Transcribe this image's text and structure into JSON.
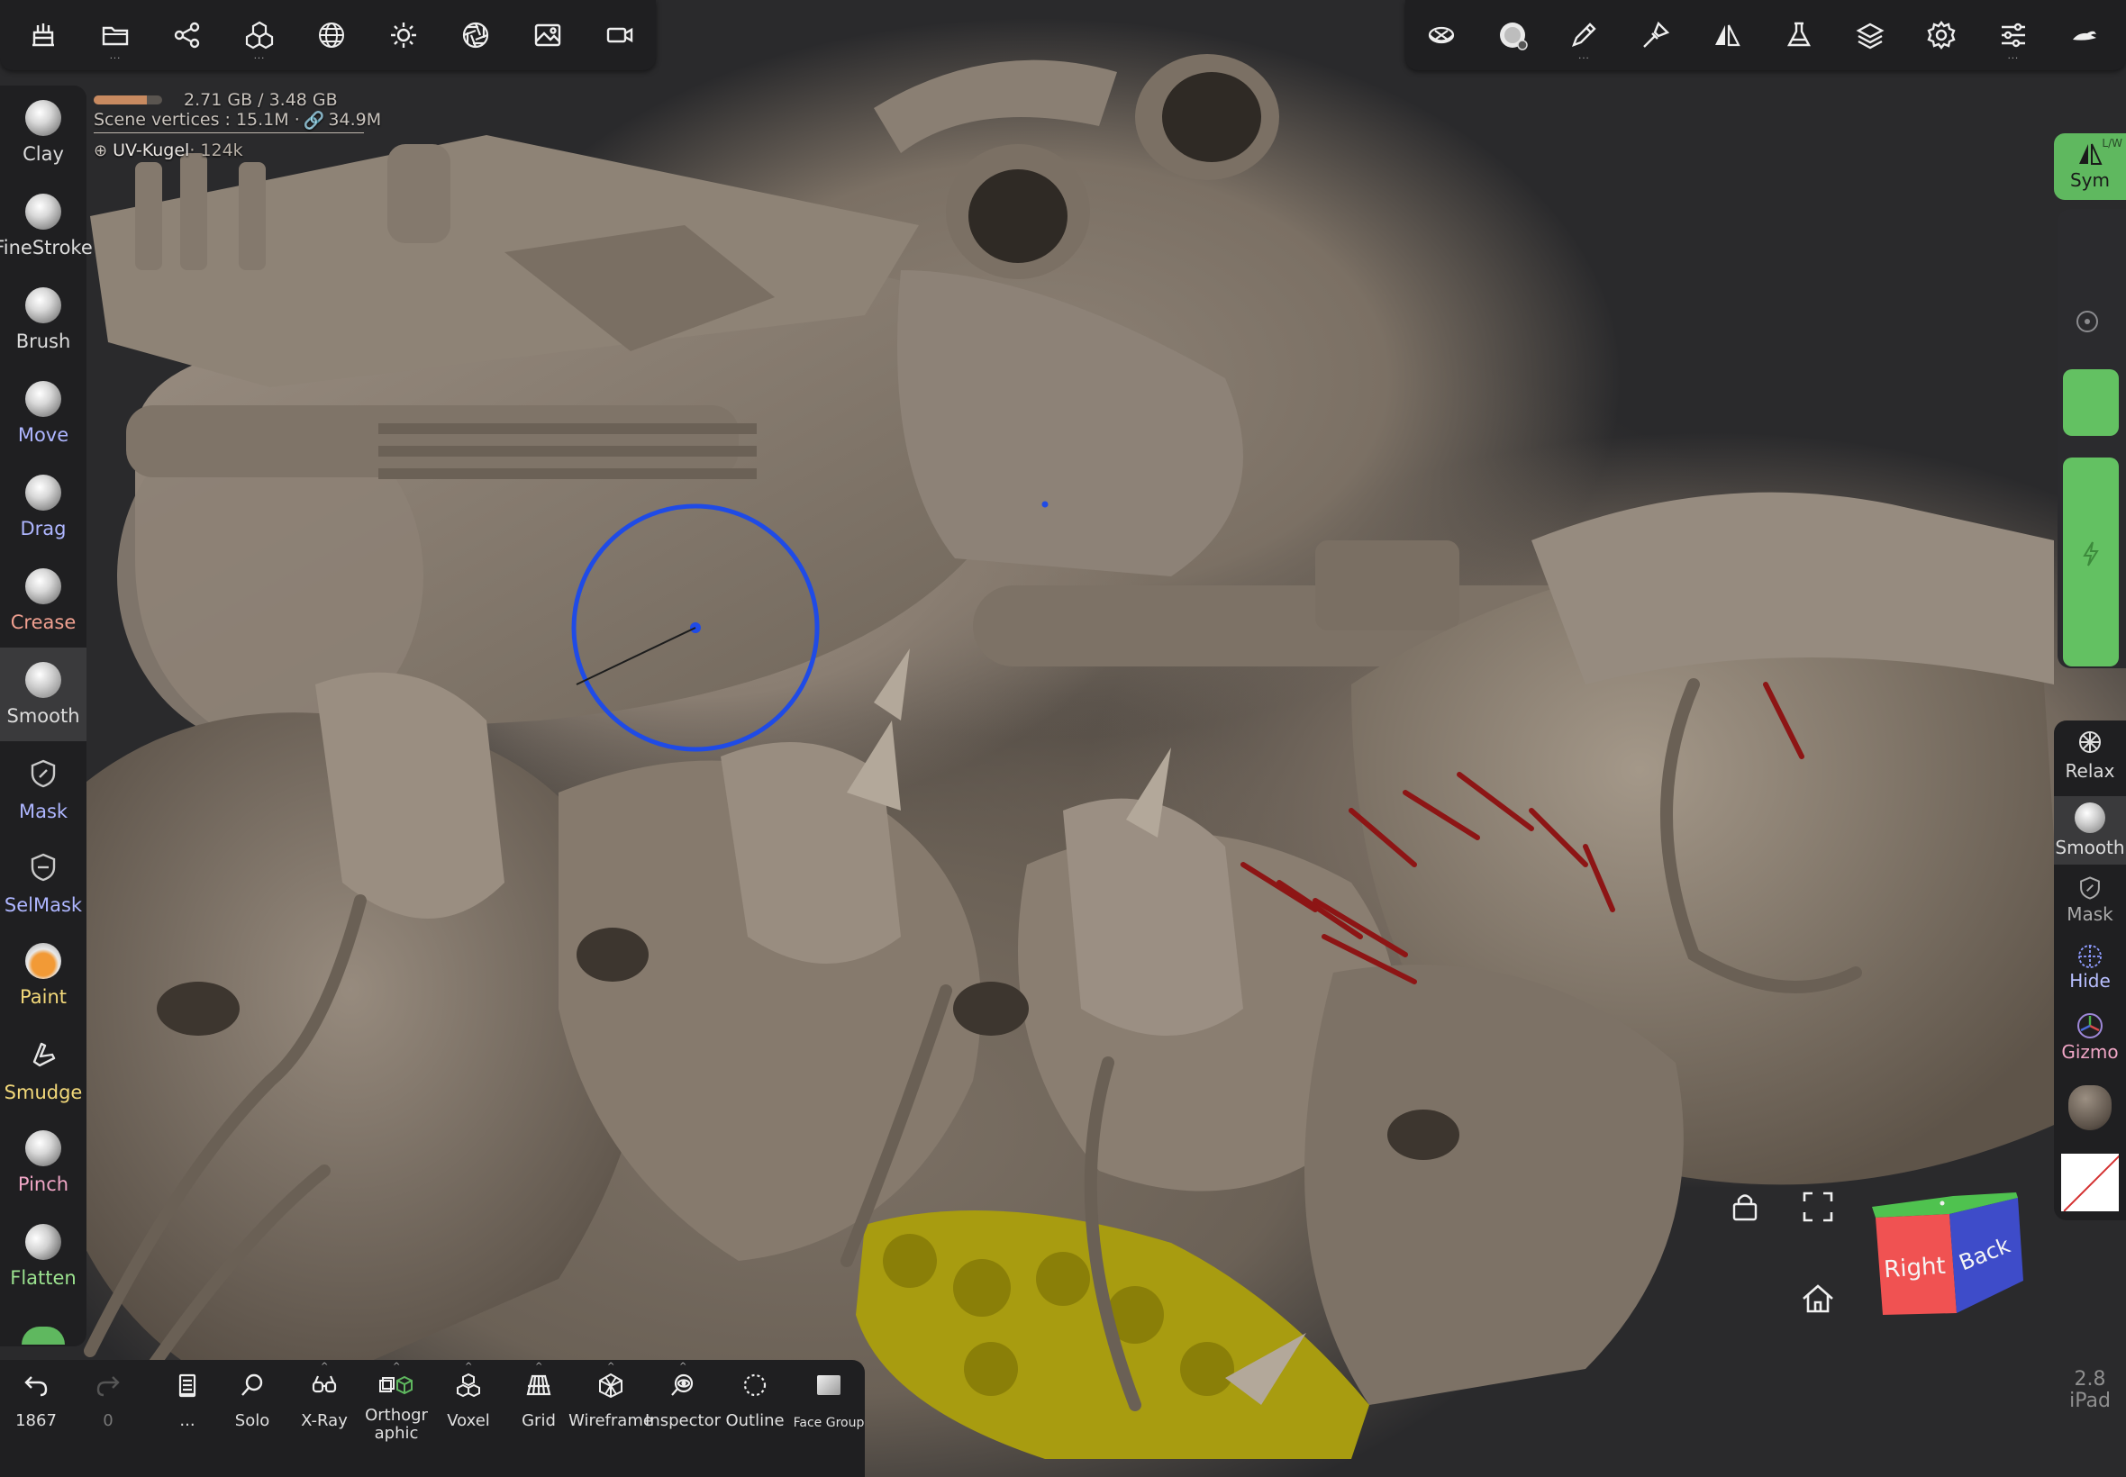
{
  "top_left_toolbar": {
    "buttons": [
      {
        "icon": "scene-stack-icon"
      },
      {
        "icon": "folder-icon",
        "more": "..."
      },
      {
        "icon": "share-nodes-icon"
      },
      {
        "icon": "primitives-icon",
        "more": "..."
      },
      {
        "icon": "globe-wireframe-icon"
      },
      {
        "icon": "sun-light-icon"
      },
      {
        "icon": "aperture-icon"
      },
      {
        "icon": "image-icon"
      },
      {
        "icon": "video-camera-icon"
      }
    ]
  },
  "top_right_toolbar": {
    "buttons": [
      {
        "icon": "mesh-cube-icon"
      },
      {
        "icon": "brush-settings-icon"
      },
      {
        "icon": "pen-stroke-icon",
        "more": "..."
      },
      {
        "icon": "paint-brush-icon"
      },
      {
        "icon": "mirror-symmetry-icon"
      },
      {
        "icon": "flask-icon"
      },
      {
        "icon": "layers-icon"
      },
      {
        "icon": "gear-icon"
      },
      {
        "icon": "sliders-icon",
        "more": "..."
      },
      {
        "icon": "cloud-swoosh-icon"
      }
    ]
  },
  "info": {
    "memory": "2.71 GB / 3.48 GB",
    "memory_fraction": 0.78,
    "scene_vertices": "Scene vertices : 15.1M · ",
    "scene_faces": "34.9M",
    "mesh_name": "UV-Kugel",
    "mesh_count": " · 124k"
  },
  "left_tools": [
    {
      "label": "Clay",
      "color": "white"
    },
    {
      "label": "FineStroke",
      "color": "white"
    },
    {
      "label": "Brush",
      "color": "white"
    },
    {
      "label": "Move",
      "color": "blue"
    },
    {
      "label": "Drag",
      "color": "blue"
    },
    {
      "label": "Crease",
      "color": "red"
    },
    {
      "label": "Smooth",
      "color": "white",
      "selected": true
    },
    {
      "label": "Mask",
      "color": "blue"
    },
    {
      "label": "SelMask",
      "color": "blue"
    },
    {
      "label": "Paint",
      "color": "yellow"
    },
    {
      "label": "Smudge",
      "color": "yellow"
    },
    {
      "label": "Pinch",
      "color": "pink"
    },
    {
      "label": "Flatten",
      "color": "green"
    }
  ],
  "right_panel": {
    "sym_label": "Sym",
    "sym_badge": "L/W",
    "intensity_value": 1.0,
    "tools": [
      {
        "label": "Relax"
      },
      {
        "label": "Smooth",
        "selected": true
      },
      {
        "label": "Mask"
      },
      {
        "label": "Hide"
      },
      {
        "label": "Gizmo"
      }
    ]
  },
  "bottom_bar": {
    "items": [
      {
        "label": "1867",
        "icon": "undo-icon"
      },
      {
        "label": "0",
        "icon": "redo-icon"
      },
      {
        "label": "...",
        "icon": "notepad-icon"
      },
      {
        "label": "Solo",
        "icon": "search-icon"
      },
      {
        "label": "X-Ray",
        "icon": "xray-glasses-icon"
      },
      {
        "label": "Orthographic",
        "icon": "orthographic-icon"
      },
      {
        "label": "Voxel",
        "icon": "voxel-icon"
      },
      {
        "label": "Grid",
        "icon": "grid-icon"
      },
      {
        "label": "Wireframe",
        "icon": "wireframe-icon"
      },
      {
        "label": "Inspector",
        "icon": "inspector-eye-icon"
      },
      {
        "label": "Outline",
        "icon": "outline-circle-icon"
      },
      {
        "label": "Face Group",
        "icon": "face-group-icon"
      }
    ]
  },
  "nav_cube": {
    "right_label": "Right",
    "back_label": "Back"
  },
  "version": {
    "number": "2.8",
    "device": "iPad"
  }
}
